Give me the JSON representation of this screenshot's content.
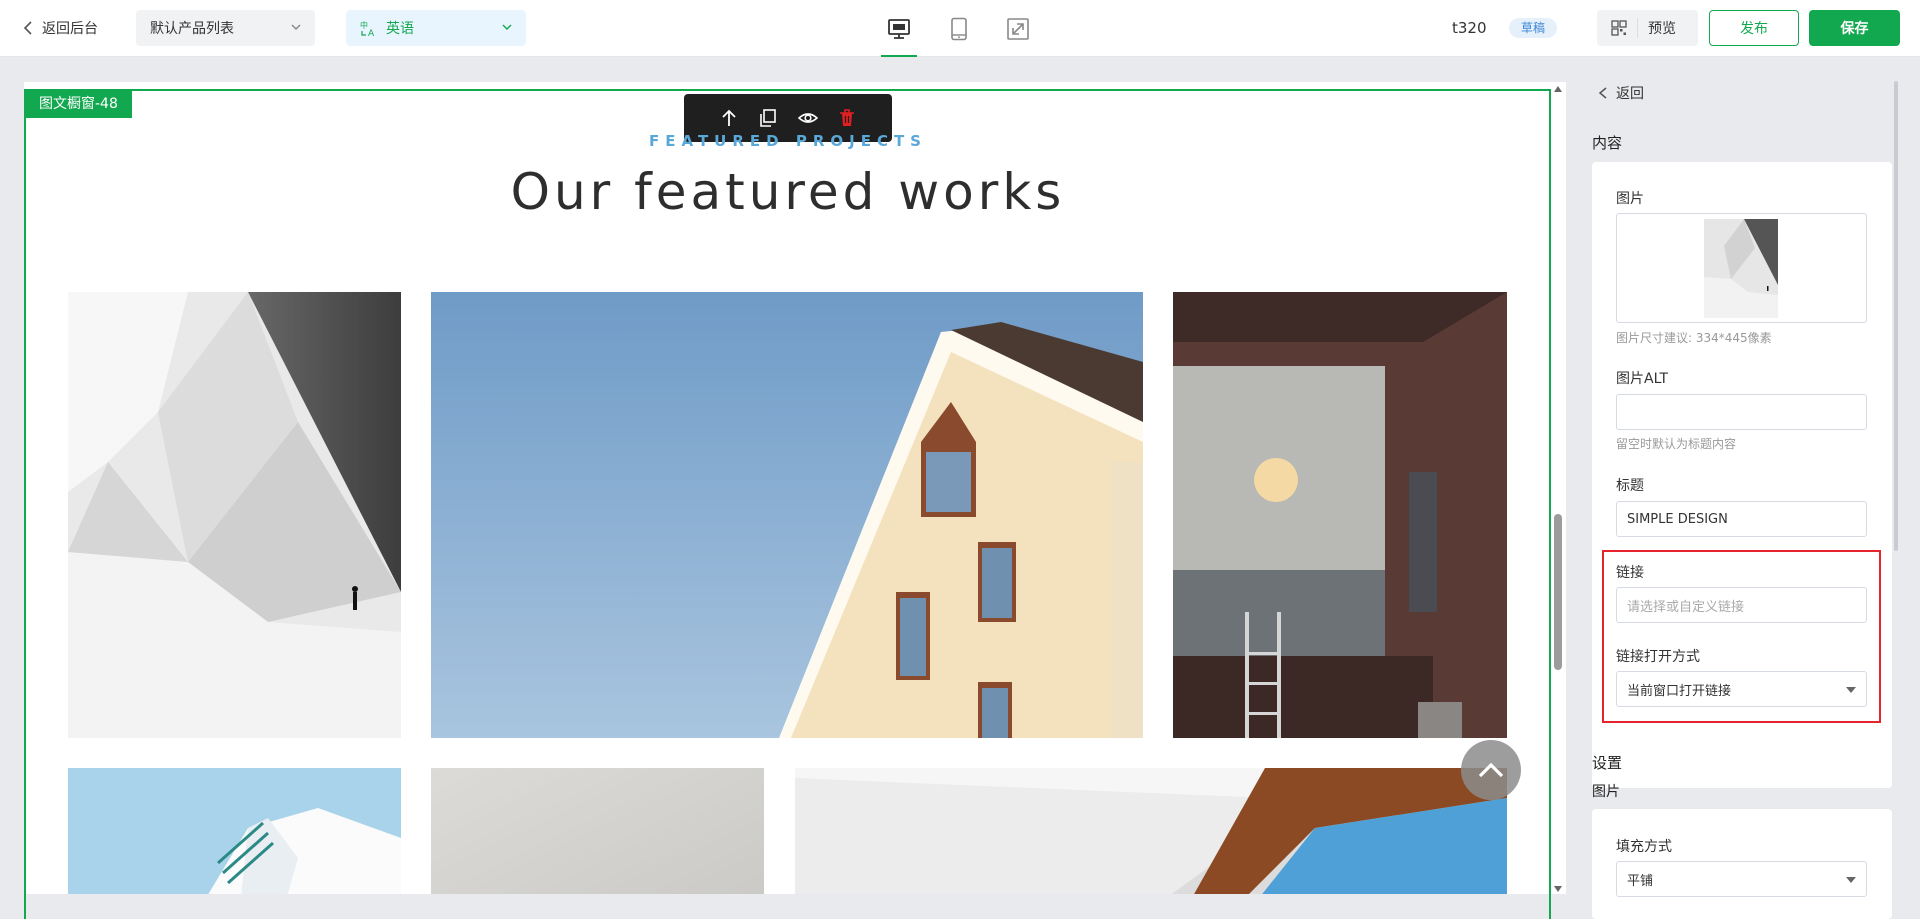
{
  "topbar": {
    "back_label": "返回后台",
    "product_select": "默认产品列表",
    "language_select": "英语",
    "site_name": "t320",
    "status_badge": "草稿",
    "preview_label": "预览",
    "publish_label": "发布",
    "save_label": "保存",
    "devices": [
      "desktop-icon",
      "tablet-icon",
      "fullscreen-icon"
    ]
  },
  "canvas": {
    "block_tag": "图文橱窗-48",
    "toolbar_icons": [
      "arrow-up-icon",
      "copy-icon",
      "eye-icon",
      "trash-icon"
    ],
    "eyebrow": "FEATURED PROJECTS",
    "headline": "Our featured works"
  },
  "panel": {
    "back_label": "返回",
    "content_title": "内容",
    "image_label": "图片",
    "image_hint": "图片尺寸建议: 334*445像素",
    "alt_label": "图片ALT",
    "alt_value": "",
    "alt_hint": "留空时默认为标题内容",
    "title_label": "标题",
    "title_value": "SIMPLE DESIGN",
    "link_label": "链接",
    "link_placeholder": "请选择或自定义链接",
    "open_mode_label": "链接打开方式",
    "open_mode_value": "当前窗口打开链接",
    "settings_title": "设置",
    "settings_image_label": "图片",
    "fill_label": "填充方式",
    "fill_value": "平铺"
  },
  "colors": {
    "accent": "#12a84f",
    "highlight": "#e5242b",
    "eyebrow": "#5aa8d8"
  }
}
